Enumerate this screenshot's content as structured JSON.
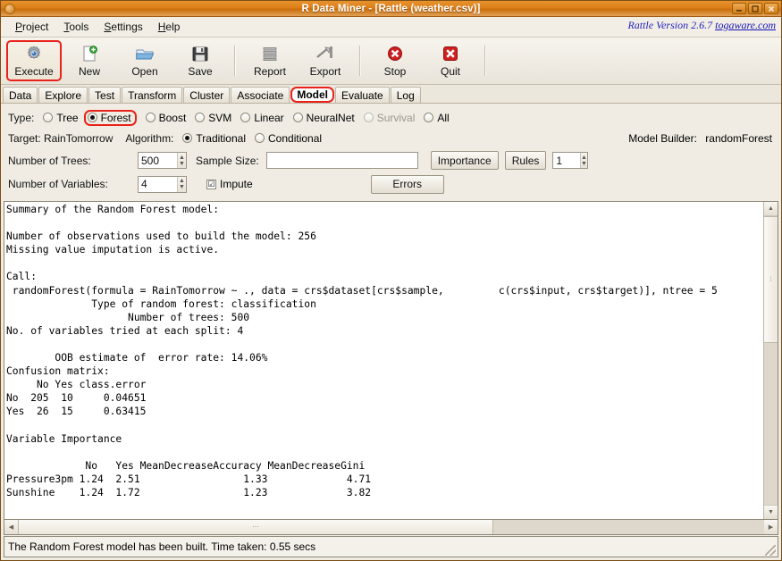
{
  "window": {
    "title": "R Data Miner - [Rattle (weather.csv)]",
    "buttons": {
      "minimize": "minimize-icon",
      "maximize": "maximize-icon",
      "close": "close-icon"
    }
  },
  "menubar": {
    "items": [
      {
        "label": "Project",
        "accel": "P"
      },
      {
        "label": "Tools",
        "accel": "T"
      },
      {
        "label": "Settings",
        "accel": "S"
      },
      {
        "label": "Help",
        "accel": "H"
      }
    ],
    "version_text": "Rattle Version 2.6.7 ",
    "version_link": "togaware.com"
  },
  "toolbar": {
    "items": [
      {
        "label": "Execute",
        "icon": "gear-icon",
        "highlighted": true
      },
      {
        "label": "New",
        "icon": "new-document-icon",
        "highlighted": false
      },
      {
        "label": "Open",
        "icon": "open-folder-icon",
        "highlighted": false
      },
      {
        "label": "Save",
        "icon": "floppy-disk-icon",
        "highlighted": false
      },
      {
        "label": "Report",
        "icon": "report-lines-icon",
        "highlighted": false
      },
      {
        "label": "Export",
        "icon": "export-icon",
        "highlighted": false
      },
      {
        "label": "Stop",
        "icon": "stop-sign-icon",
        "highlighted": false
      },
      {
        "label": "Quit",
        "icon": "quit-x-icon",
        "highlighted": false
      }
    ]
  },
  "tabs": {
    "items": [
      {
        "label": "Data",
        "active": false
      },
      {
        "label": "Explore",
        "active": false
      },
      {
        "label": "Test",
        "active": false
      },
      {
        "label": "Transform",
        "active": false
      },
      {
        "label": "Cluster",
        "active": false
      },
      {
        "label": "Associate",
        "active": false
      },
      {
        "label": "Model",
        "active": true
      },
      {
        "label": "Evaluate",
        "active": false
      },
      {
        "label": "Log",
        "active": false
      }
    ]
  },
  "options": {
    "type_label": "Type:",
    "type_options": [
      {
        "label": "Tree",
        "selected": false,
        "disabled": false,
        "highlighted": false
      },
      {
        "label": "Forest",
        "selected": true,
        "disabled": false,
        "highlighted": true
      },
      {
        "label": "Boost",
        "selected": false,
        "disabled": false,
        "highlighted": false
      },
      {
        "label": "SVM",
        "selected": false,
        "disabled": false,
        "highlighted": false
      },
      {
        "label": "Linear",
        "selected": false,
        "disabled": false,
        "highlighted": false
      },
      {
        "label": "NeuralNet",
        "selected": false,
        "disabled": false,
        "highlighted": false
      },
      {
        "label": "Survival",
        "selected": false,
        "disabled": true,
        "highlighted": false
      },
      {
        "label": "All",
        "selected": false,
        "disabled": false,
        "highlighted": false
      }
    ],
    "target_label": "Target: RainTomorrow",
    "algorithm_label": "Algorithm:",
    "algorithm_options": [
      {
        "label": "Traditional",
        "selected": true
      },
      {
        "label": "Conditional",
        "selected": false
      }
    ],
    "model_builder_label": "Model Builder:",
    "model_builder_value": "randomForest",
    "num_trees_label": "Number of Trees:",
    "num_trees_value": "500",
    "sample_size_label": "Sample Size:",
    "sample_size_value": "",
    "importance_button": "Importance",
    "rules_button": "Rules",
    "rules_value": "1",
    "num_variables_label": "Number of Variables:",
    "num_variables_value": "4",
    "impute_label": "Impute",
    "impute_checked": "☑",
    "errors_button": "Errors"
  },
  "output": {
    "text": "Summary of the Random Forest model:\n\nNumber of observations used to build the model: 256\nMissing value imputation is active.\n\nCall:\n randomForest(formula = RainTomorrow ~ ., data = crs$dataset[crs$sample,         c(crs$input, crs$target)], ntree = 5\n              Type of random forest: classification\n                    Number of trees: 500\nNo. of variables tried at each split: 4\n\n        OOB estimate of  error rate: 14.06%\nConfusion matrix:\n     No Yes class.error\nNo  205  10     0.04651\nYes  26  15     0.63415\n\nVariable Importance\n\n             No   Yes MeanDecreaseAccuracy MeanDecreaseGini\nPressure3pm 1.24  2.51                 1.33             4.71\nSunshine    1.24  1.72                 1.23             3.82"
  },
  "statusbar": {
    "text": "The Random Forest model has been built. Time taken: 0.55 secs"
  },
  "colors": {
    "titlebar": "#dc7f18",
    "highlight": "#e8211a",
    "link": "#1414b4",
    "panel": "#f0ece3"
  }
}
